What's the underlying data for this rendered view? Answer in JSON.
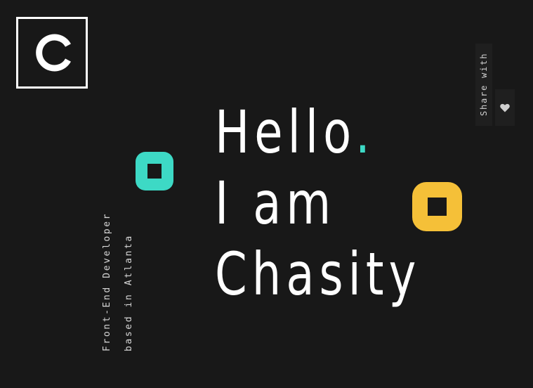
{
  "logo": {
    "letter": "C",
    "icon": "c-logo-icon"
  },
  "hero": {
    "line1": "Hello",
    "dot": ".",
    "line2": "I am",
    "line3": "Chasity"
  },
  "tagline": {
    "line1": "Front-End Developer",
    "line2": "based in Atlanta"
  },
  "share": {
    "label": "Share with",
    "icon": "heart-icon"
  },
  "decor": {
    "teal_ring_color": "#3dd9c5",
    "yellow_ring_color": "#f5c038"
  },
  "colors": {
    "background": "#181818",
    "text": "#ffffff",
    "accent": "#3dd9c5"
  }
}
